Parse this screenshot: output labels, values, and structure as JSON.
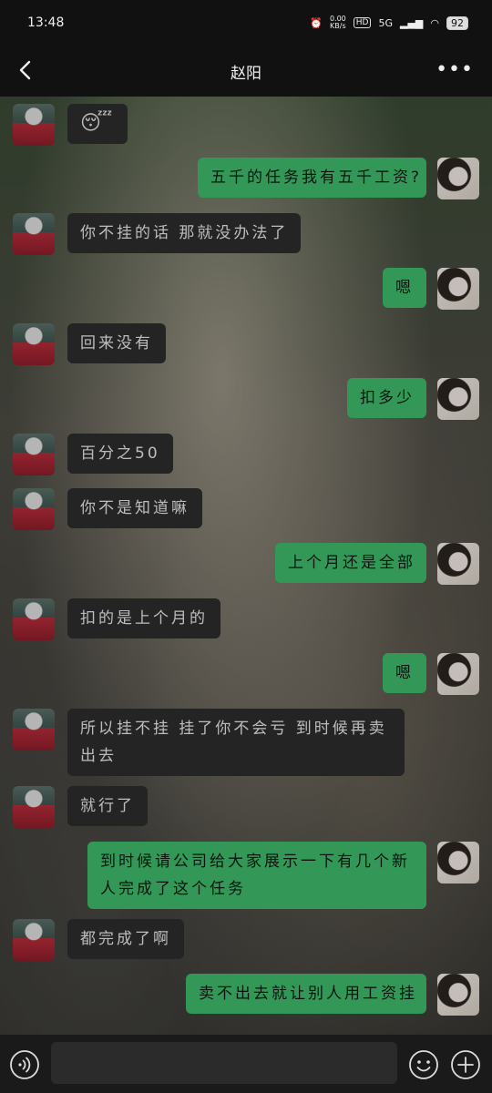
{
  "status": {
    "time": "13:48",
    "net_speed": "0.00\nKB/s",
    "hd": "HD",
    "signal": "5G",
    "battery": "92"
  },
  "header": {
    "title": "赵阳"
  },
  "messages": [
    {
      "side": "left",
      "text": "😴"
    },
    {
      "side": "right",
      "text": "五千的任务我有五千工资?"
    },
    {
      "side": "left",
      "text": "你不挂的话 那就没办法了"
    },
    {
      "side": "right",
      "text": "嗯"
    },
    {
      "side": "left",
      "text": "回来没有"
    },
    {
      "side": "right",
      "text": "扣多少"
    },
    {
      "side": "left",
      "text": "百分之50"
    },
    {
      "side": "left",
      "text": "你不是知道嘛"
    },
    {
      "side": "right",
      "text": "上个月还是全部"
    },
    {
      "side": "left",
      "text": "扣的是上个月的"
    },
    {
      "side": "right",
      "text": "嗯"
    },
    {
      "side": "left",
      "text": "所以挂不挂 挂了你不会亏 到时候再卖出去"
    },
    {
      "side": "left",
      "text": "就行了"
    },
    {
      "side": "right",
      "text": "到时候请公司给大家展示一下有几个新人完成了这个任务"
    },
    {
      "side": "left",
      "text": "都完成了啊"
    },
    {
      "side": "right",
      "text": "卖不出去就让别人用工资挂"
    }
  ],
  "input": {
    "placeholder": ""
  },
  "icons": {
    "back": "back-arrow-icon",
    "more": "more-icon",
    "voice": "voice-icon",
    "emoji": "emoji-icon",
    "plus": "plus-icon"
  },
  "colors": {
    "bubble_right": "#3fb96b",
    "bubble_left": "#2c2c2c"
  }
}
